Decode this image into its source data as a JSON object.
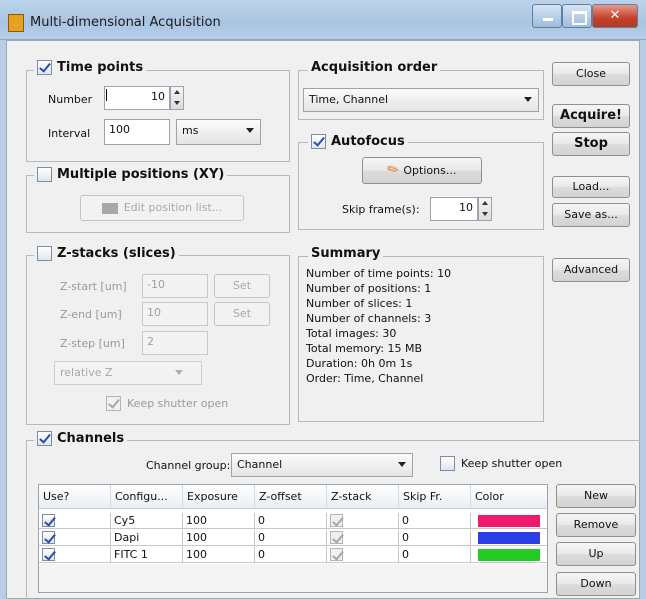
{
  "window": {
    "title": "Multi-dimensional Acquisition"
  },
  "colors": {
    "cy5": "#ef1a6e",
    "dapi": "#2c3fe6",
    "fitc": "#22cc22"
  },
  "time_points": {
    "label": "Time points",
    "checked": true,
    "number_label": "Number",
    "number_value": "10",
    "interval_label": "Interval",
    "interval_value": "100",
    "interval_unit": "ms"
  },
  "positions": {
    "label": "Multiple positions (XY)",
    "checked": false,
    "edit_button": "Edit position list..."
  },
  "zstacks": {
    "label": "Z-stacks (slices)",
    "checked": false,
    "start_label": "Z-start [um]",
    "start_value": "-10",
    "end_label": "Z-end [um]",
    "end_value": "10",
    "step_label": "Z-step [um]",
    "step_value": "2",
    "set_label": "Set",
    "mode": "relative Z",
    "keep_shutter": "Keep shutter open"
  },
  "acq_order": {
    "label": "Acquisition order",
    "value": "Time, Channel"
  },
  "autofocus": {
    "label": "Autofocus",
    "checked": true,
    "options_button": "Options...",
    "skip_label": "Skip frame(s):",
    "skip_value": "10"
  },
  "summary": {
    "label": "Summary",
    "lines": [
      "Number of time points: 10",
      "Number of positions: 1",
      "Number of slices: 1",
      "Number of channels: 3",
      "Total images: 30",
      "Total memory: 15 MB",
      "Duration: 0h 0m 1s",
      "Order: Time, Channel"
    ]
  },
  "actions": {
    "close": "Close",
    "acquire": "Acquire!",
    "stop": "Stop",
    "load": "Load...",
    "save_as": "Save as...",
    "advanced": "Advanced"
  },
  "channels": {
    "label": "Channels",
    "checked": true,
    "group_label": "Channel group:",
    "group_value": "Channel",
    "keep_shutter": "Keep shutter open",
    "columns": [
      "Use?",
      "Configu...",
      "Exposure",
      "Z-offset",
      "Z-stack",
      "Skip Fr.",
      "Color"
    ],
    "rows": [
      {
        "use": true,
        "config": "Cy5",
        "exposure": "100",
        "zoffset": "0",
        "zstack": true,
        "skip": "0",
        "color": "#ef1a6e"
      },
      {
        "use": true,
        "config": "Dapi",
        "exposure": "100",
        "zoffset": "0",
        "zstack": true,
        "skip": "0",
        "color": "#2c3fe6"
      },
      {
        "use": true,
        "config": "FITC 1",
        "exposure": "100",
        "zoffset": "0",
        "zstack": true,
        "skip": "0",
        "color": "#22cc22"
      }
    ],
    "buttons": {
      "new": "New",
      "remove": "Remove",
      "up": "Up",
      "down": "Down"
    }
  }
}
